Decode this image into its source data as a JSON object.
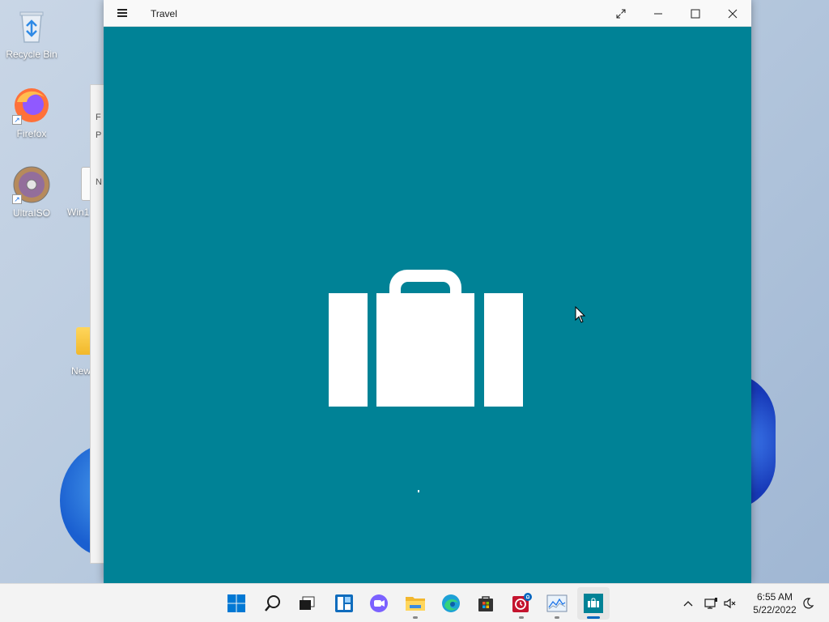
{
  "desktop": {
    "icons": [
      {
        "label": "Recycle Bin"
      },
      {
        "label": "Firefox"
      },
      {
        "label": "UltraISO"
      }
    ],
    "partial_labels": [
      "Win1",
      "New"
    ],
    "background_window_rows": [
      "F",
      "P",
      "N"
    ]
  },
  "window": {
    "title": "Travel",
    "accent_color": "#008296",
    "splash_icon": "briefcase-icon"
  },
  "taskbar": {
    "apps": [
      "start-icon",
      "search-icon",
      "task-view-icon",
      "widgets-icon",
      "chat-icon",
      "file-explorer-icon",
      "edge-icon",
      "store-icon",
      "alarms-icon",
      "performance-monitor-icon",
      "travel-app-icon"
    ],
    "clock": {
      "time": "6:55 AM",
      "date": "5/22/2022"
    }
  }
}
